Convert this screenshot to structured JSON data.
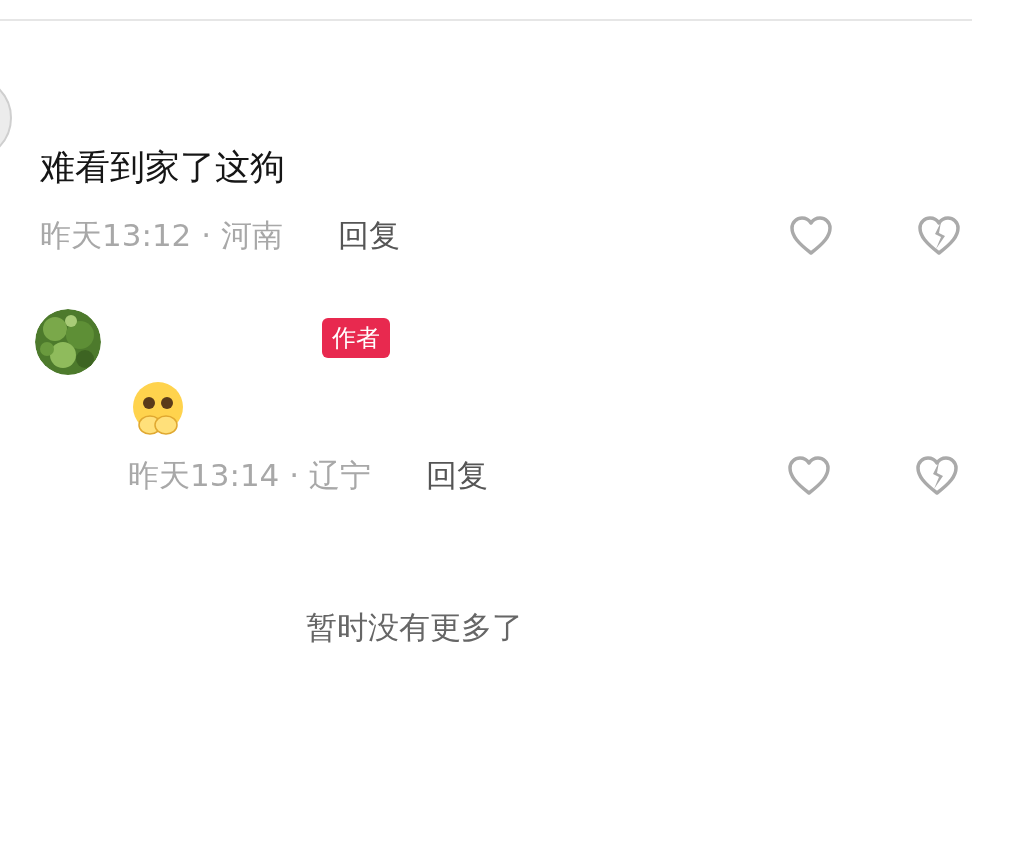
{
  "comments": [
    {
      "avatar": {
        "kind": "placeholder"
      },
      "content": {
        "kind": "text",
        "text": "难看到家了这狗"
      },
      "time": "昨天13:12 · 河南",
      "reply": "回复",
      "children": [
        {
          "badge": "作者",
          "content": {
            "kind": "emoji"
          },
          "time": "昨天13:14 · 辽宁",
          "reply": "回复"
        }
      ]
    }
  ],
  "footer": "暂时没有更多了"
}
